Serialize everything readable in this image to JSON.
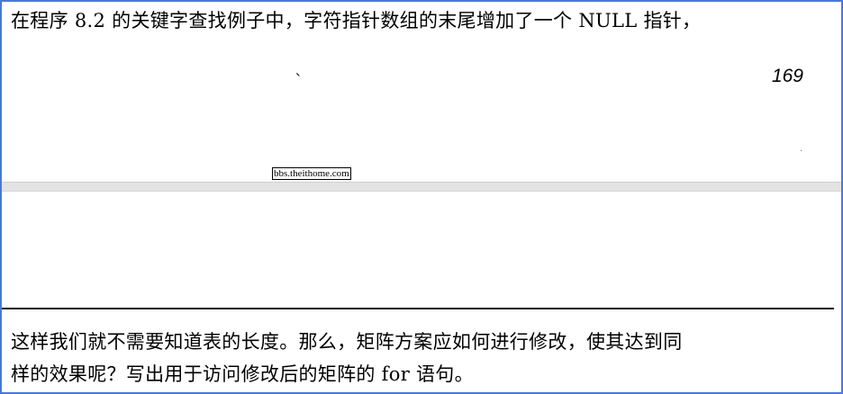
{
  "document": {
    "top_paragraph_line": "在程序 8.2 的关键字查找例子中，字符指针数组的末尾增加了一个 NULL 指针，",
    "page_number": "169",
    "watermark_text": "bbs.theithome.com",
    "bottom_paragraph_lines": [
      "这样我们就不需要知道表的长度。那么，矩阵方案应如何进行修改，使其达到同",
      "样的效果呢？写出用于访问修改后的矩阵的 for 语句。"
    ]
  },
  "colors": {
    "frame_border": "#4a78d6",
    "page_gap": "#e3e3e3",
    "text": "#000000"
  }
}
